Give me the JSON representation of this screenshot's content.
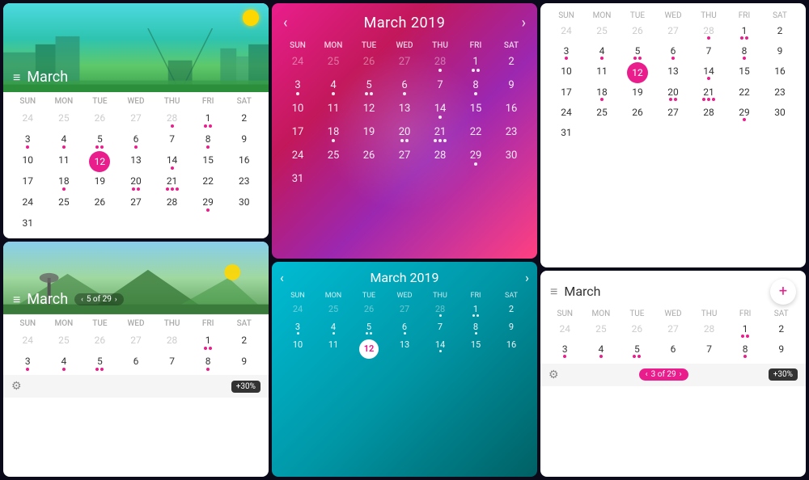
{
  "calendars": {
    "month": "March",
    "month_year": "March 2019",
    "year": "2019",
    "today": 12,
    "days_of_week": [
      "SUN",
      "MON",
      "TUE",
      "WED",
      "THU",
      "FRI",
      "SAT"
    ],
    "pagination": "5 of 29",
    "pagination2": "3 of 29",
    "nav_prev": "‹",
    "nav_next": "›",
    "plus_label": "+",
    "settings_label": "⚙",
    "more_pct": "+30%",
    "hamburger": "≡",
    "weeks": [
      [
        {
          "d": 24,
          "m": "prev"
        },
        {
          "d": 25,
          "m": "prev"
        },
        {
          "d": 26,
          "m": "prev"
        },
        {
          "d": 27,
          "m": "prev"
        },
        {
          "d": 28,
          "m": "prev",
          "dots": 1
        },
        {
          "d": 1,
          "m": "curr",
          "dots": 2
        },
        {
          "d": 2,
          "m": "curr"
        }
      ],
      [
        {
          "d": 3,
          "m": "curr",
          "dots": 1
        },
        {
          "d": 4,
          "m": "curr",
          "dots": 1
        },
        {
          "d": 5,
          "m": "curr",
          "dots": 2
        },
        {
          "d": 6,
          "m": "curr",
          "dots": 1
        },
        {
          "d": 7,
          "m": "curr"
        },
        {
          "d": 8,
          "m": "curr",
          "dots": 1
        },
        {
          "d": 9,
          "m": "curr"
        }
      ],
      [
        {
          "d": 10,
          "m": "curr"
        },
        {
          "d": 11,
          "m": "curr"
        },
        {
          "d": 12,
          "m": "curr",
          "today": true
        },
        {
          "d": 13,
          "m": "curr"
        },
        {
          "d": 14,
          "m": "curr",
          "dots": 1
        },
        {
          "d": 15,
          "m": "curr"
        },
        {
          "d": 16,
          "m": "curr"
        }
      ],
      [
        {
          "d": 17,
          "m": "curr"
        },
        {
          "d": 18,
          "m": "curr",
          "dots": 1
        },
        {
          "d": 19,
          "m": "curr"
        },
        {
          "d": 20,
          "m": "curr",
          "dots": 2
        },
        {
          "d": 21,
          "m": "curr",
          "dots": 3
        },
        {
          "d": 22,
          "m": "curr"
        },
        {
          "d": 23,
          "m": "curr"
        }
      ],
      [
        {
          "d": 24,
          "m": "curr"
        },
        {
          "d": 25,
          "m": "curr"
        },
        {
          "d": 26,
          "m": "curr"
        },
        {
          "d": 27,
          "m": "curr"
        },
        {
          "d": 28,
          "m": "curr"
        },
        {
          "d": 29,
          "m": "curr",
          "dots": 1
        },
        {
          "d": 30,
          "m": "curr"
        }
      ],
      [
        {
          "d": 31,
          "m": "curr"
        }
      ]
    ],
    "weeks_partial": [
      [
        {
          "d": 24,
          "m": "prev"
        },
        {
          "d": 25,
          "m": "prev"
        },
        {
          "d": 26,
          "m": "prev"
        },
        {
          "d": 27,
          "m": "prev"
        },
        {
          "d": 28,
          "m": "prev"
        },
        {
          "d": 1,
          "m": "curr",
          "dots": 2
        },
        {
          "d": 2,
          "m": "curr"
        }
      ],
      [
        {
          "d": 3,
          "m": "curr",
          "dots": 1
        },
        {
          "d": 4,
          "m": "curr",
          "dots": 1
        },
        {
          "d": 5,
          "m": "curr",
          "dots": 2
        },
        {
          "d": 6,
          "m": "curr"
        },
        {
          "d": 7,
          "m": "curr"
        },
        {
          "d": 8,
          "m": "curr",
          "dots": 1
        },
        {
          "d": 9,
          "m": "curr"
        }
      ]
    ],
    "weeks_teal": [
      [
        {
          "d": 24,
          "m": "prev"
        },
        {
          "d": 25,
          "m": "prev"
        },
        {
          "d": 26,
          "m": "prev"
        },
        {
          "d": 27,
          "m": "prev"
        },
        {
          "d": 28,
          "m": "prev",
          "dots": 1
        },
        {
          "d": 1,
          "m": "curr",
          "dots": 2
        },
        {
          "d": 2,
          "m": "curr"
        }
      ],
      [
        {
          "d": 3,
          "m": "curr",
          "dots": 1
        },
        {
          "d": 4,
          "m": "curr",
          "dots": 1
        },
        {
          "d": 5,
          "m": "curr",
          "dots": 2
        },
        {
          "d": 6,
          "m": "curr",
          "dots": 1
        },
        {
          "d": 7,
          "m": "curr"
        },
        {
          "d": 8,
          "m": "curr",
          "dots": 1
        },
        {
          "d": 9,
          "m": "curr"
        }
      ],
      [
        {
          "d": 10,
          "m": "curr"
        },
        {
          "d": 11,
          "m": "curr"
        },
        {
          "d": 12,
          "m": "curr",
          "today": true
        },
        {
          "d": 13,
          "m": "curr"
        },
        {
          "d": 14,
          "m": "curr",
          "dots": 1
        },
        {
          "d": 15,
          "m": "curr"
        },
        {
          "d": 16,
          "m": "curr"
        }
      ]
    ]
  }
}
